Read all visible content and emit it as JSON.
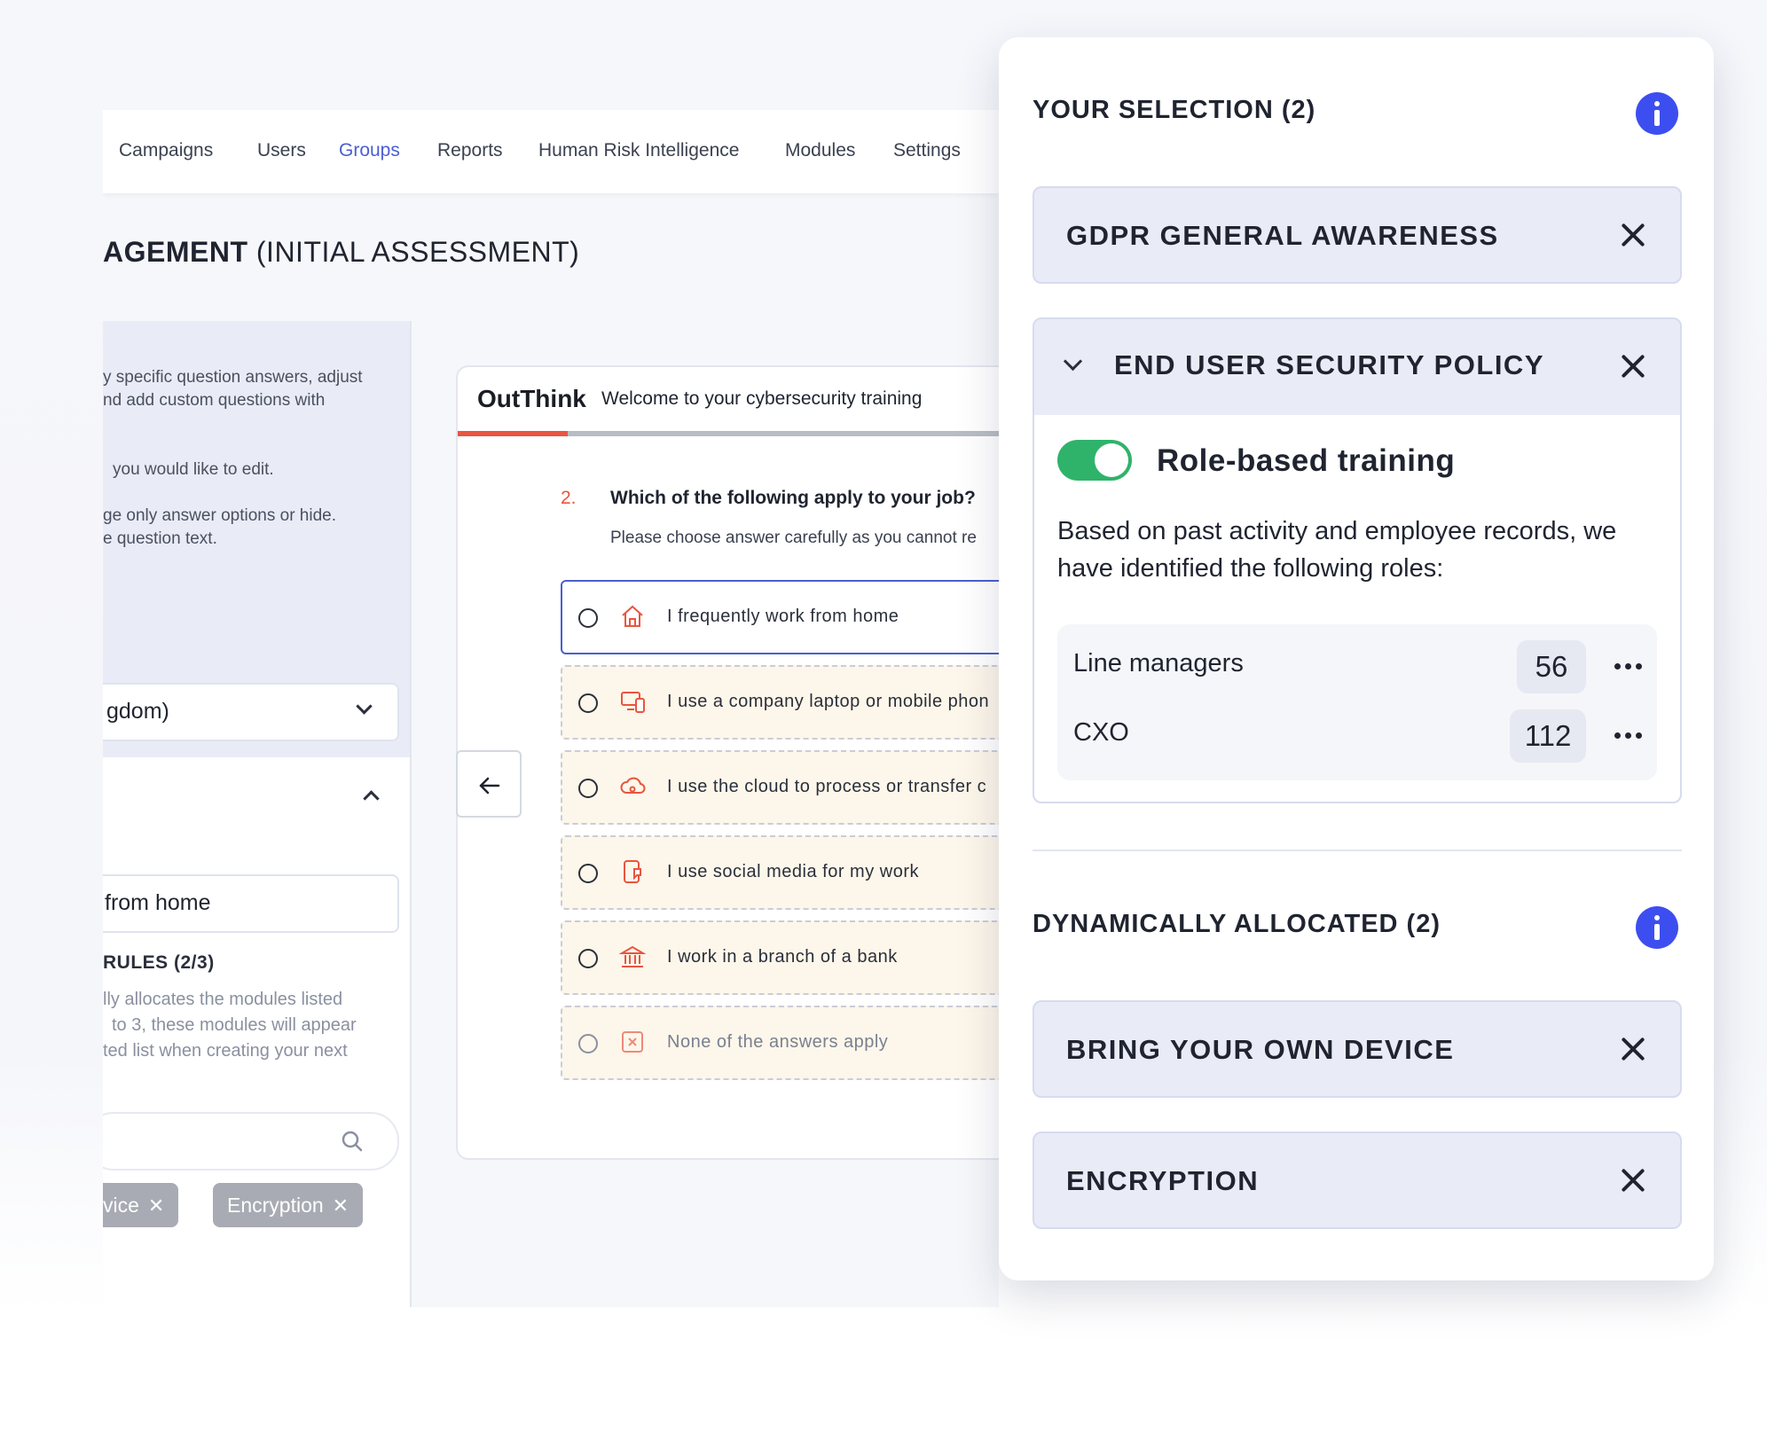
{
  "nav": {
    "items": [
      {
        "label": "Campaigns",
        "active": false
      },
      {
        "label": "Users",
        "active": false
      },
      {
        "label": "Groups",
        "active": true
      },
      {
        "label": "Reports",
        "active": false
      },
      {
        "label": "Human Risk Intelligence",
        "active": false
      },
      {
        "label": "Modules",
        "active": false
      },
      {
        "label": "Settings",
        "active": false
      }
    ]
  },
  "page": {
    "title_bold": "AGEMENT",
    "title_rest": " (INITIAL ASSESSMENT)"
  },
  "left_panel": {
    "intro_lines": [
      "y specific question answers, adjust",
      "nd add custom questions with"
    ],
    "edit_line": "you would like to edit.",
    "hide_lines": [
      "ge only answer options or hide.",
      "e question text."
    ],
    "language_value": "gdom)",
    "answer_value": "from home",
    "rules_label": "RULES (2/3)",
    "rules_desc": [
      "lly allocates the modules listed",
      "to 3, these modules will appear",
      "ted list when creating your next"
    ],
    "chips": [
      "vice",
      "Encryption"
    ]
  },
  "survey": {
    "logo": "OutThink",
    "title": "Welcome to your cybersecurity training",
    "progress": 0.2,
    "question_number": "2.",
    "question": "Which of the following apply to your job?",
    "hint": "Please choose answer carefully as you cannot re",
    "options": [
      {
        "label": "I frequently work from home",
        "icon": "home-icon",
        "selected": true
      },
      {
        "label": "I use a company laptop or mobile phon",
        "icon": "devices-icon",
        "selected": false
      },
      {
        "label": "I use the cloud to process or transfer c",
        "icon": "cloud-icon",
        "selected": false
      },
      {
        "label": "I use social media for my work",
        "icon": "social-media-icon",
        "selected": false
      },
      {
        "label": "I work in a branch of a bank",
        "icon": "bank-icon",
        "selected": false
      },
      {
        "label": "None of the answers apply",
        "icon": "close-box-icon",
        "selected": false
      }
    ]
  },
  "selection_panel": {
    "your_selection_title": "YOUR SELECTION (2)",
    "modules": [
      {
        "title": "GDPR GENERAL AWARENESS"
      },
      {
        "title": "END USER SECURITY POLICY",
        "expanded": true
      }
    ],
    "role_toggle_label": "Role-based training",
    "role_toggle_on": true,
    "role_desc": "Based on past activity and employee records, we have identified the following roles:",
    "roles": [
      {
        "name": "Line managers",
        "count": "56"
      },
      {
        "name": "CXO",
        "count": "112"
      }
    ],
    "dynamic_title": "DYNAMICALLY ALLOCATED (2)",
    "dynamic_modules": [
      {
        "title": "BRING YOUR OWN DEVICE"
      },
      {
        "title": "ENCRYPTION"
      }
    ]
  },
  "colors": {
    "accent": "#4a5fd0",
    "info": "#3d4ef0",
    "toggle_on": "#2fb36a",
    "brand_orange": "#e9553f"
  }
}
